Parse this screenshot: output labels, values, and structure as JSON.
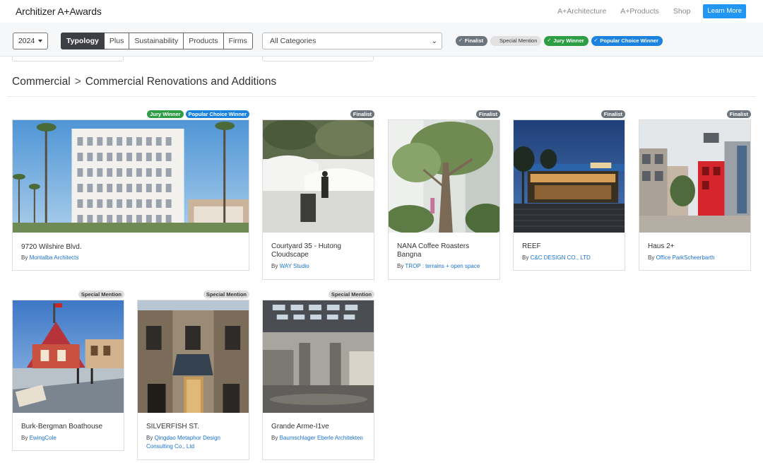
{
  "header": {
    "logo_brand": "Architizer",
    "logo_product": " A+Awards",
    "nav": [
      "A+Architecture",
      "A+Products",
      "Shop"
    ],
    "cta": "Learn More"
  },
  "filters": {
    "year": "2024",
    "segments": [
      {
        "label": "Typology",
        "active": true
      },
      {
        "label": "Plus",
        "active": false
      },
      {
        "label": "Sustainability",
        "active": false
      },
      {
        "label": "Products",
        "active": false
      },
      {
        "label": "Firms",
        "active": false
      }
    ],
    "category": "All Categories",
    "legend": {
      "finalist": "Finalist",
      "special": "Special Mention",
      "jury": "Jury Winner",
      "popular": "Popular Choice Winner"
    }
  },
  "breadcrumb": {
    "parent": "Commercial",
    "separator": ">",
    "current": "Commercial Renovations and Additions"
  },
  "by_prefix": "By",
  "projects": [
    {
      "title": "9720 Wilshire Blvd.",
      "firm": "Montalba Architects",
      "badges": [
        "Jury Winner",
        "Popular Choice Winner"
      ]
    },
    {
      "title": "Courtyard 35 - Hutong Cloudscape",
      "firm": "WAY Studio",
      "badges": [
        "Finalist"
      ]
    },
    {
      "title": "NANA Coffee Roasters Bangna",
      "firm": "TROP : terrains + open space",
      "badges": [
        "Finalist"
      ]
    },
    {
      "title": "REEF",
      "firm": "C&C DESIGN CO., LTD",
      "badges": [
        "Finalist"
      ]
    },
    {
      "title": "Haus 2+",
      "firm": "Office ParkScheerbarth",
      "badges": [
        "Finalist"
      ]
    },
    {
      "title": "Burk-Bergman Boathouse",
      "firm": "EwingCole",
      "badges": [
        "Special Mention"
      ]
    },
    {
      "title": "SILVERFISH ST.",
      "firm": "Qingdao Metaphor Design Consulting Co., Ltd",
      "badges": [
        "Special Mention"
      ]
    },
    {
      "title": "Grande Arme-I1ve",
      "firm": "Baumschlager Eberle Architekten",
      "badges": [
        "Special Mention"
      ]
    }
  ],
  "colors": {
    "accent": "#2196f3",
    "finalist": "#6c757d",
    "jury": "#2e9e45",
    "popular": "#1b82e0",
    "link": "#1b72d6"
  }
}
